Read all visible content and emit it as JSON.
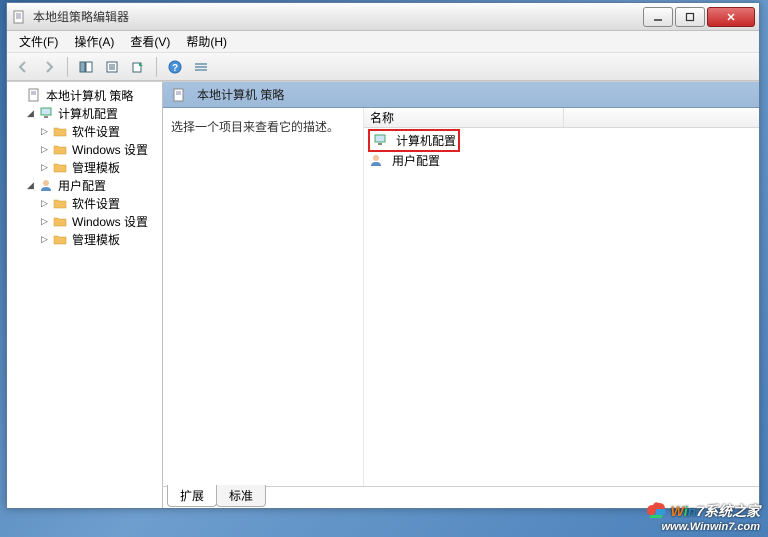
{
  "window": {
    "title": "本地组策略编辑器"
  },
  "menu": {
    "file": "文件(F)",
    "action": "操作(A)",
    "view": "查看(V)",
    "help": "帮助(H)"
  },
  "toolbar": {
    "back": "back",
    "forward": "forward",
    "up": "up",
    "showhide": "showhide",
    "export": "export",
    "refresh": "refresh",
    "help": "help",
    "props": "properties"
  },
  "tree": {
    "root": "本地计算机 策略",
    "computer": "计算机配置",
    "user": "用户配置",
    "soft": "软件设置",
    "windows": "Windows 设置",
    "admin": "管理模板"
  },
  "main": {
    "header": "本地计算机 策略",
    "desc": "选择一个项目来查看它的描述。",
    "col_name": "名称",
    "items": {
      "computer": "计算机配置",
      "user": "用户配置"
    }
  },
  "tabs": {
    "extended": "扩展",
    "standard": "标准"
  },
  "watermark": {
    "brand": "Win7系统之家",
    "url": "www.Winwin7.com"
  }
}
